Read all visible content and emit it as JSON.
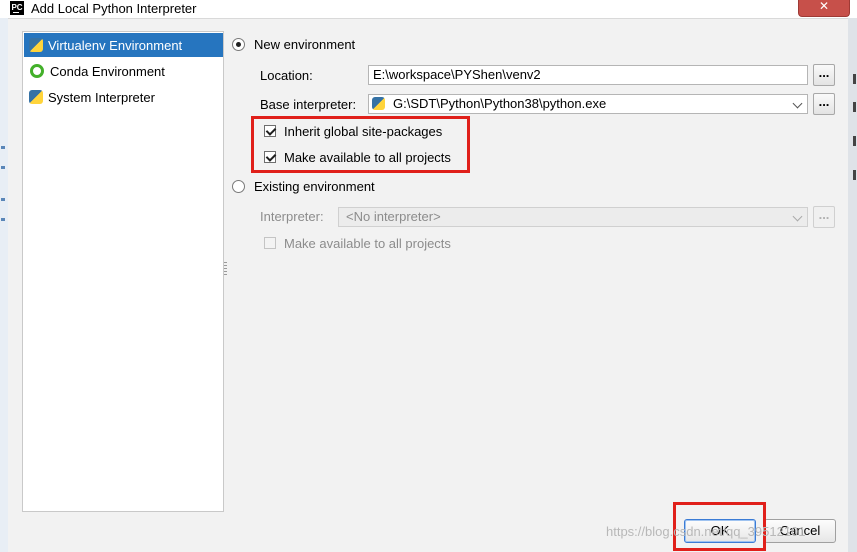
{
  "window": {
    "app_icon_text": "PC",
    "title": "Add Local Python Interpreter",
    "close_glyph": "✕"
  },
  "sidebar": {
    "items": [
      {
        "label": "Virtualenv Environment",
        "icon": "python-virtualenv-icon",
        "selected": true
      },
      {
        "label": "Conda Environment",
        "icon": "conda-icon",
        "selected": false
      },
      {
        "label": "System Interpreter",
        "icon": "python-icon",
        "selected": false
      }
    ]
  },
  "new_env": {
    "label": "New environment",
    "selected": true,
    "location_label": "Location:",
    "location_value": "E:\\workspace\\PYShen\\venv2",
    "base_label": "Base interpreter:",
    "base_value": "G:\\SDT\\Python\\Python38\\python.exe",
    "browse": "...",
    "inherit_label": "Inherit global site-packages",
    "inherit_checked": true,
    "make_available_label": "Make available to all projects",
    "make_available_checked": true
  },
  "existing_env": {
    "label": "Existing environment",
    "selected": false,
    "interpreter_label": "Interpreter:",
    "interpreter_value": "<No interpreter>",
    "browse": "...",
    "make_available_label": "Make available to all projects",
    "make_available_checked": false
  },
  "footer": {
    "ok_label": "OK",
    "cancel_label": "Cancel",
    "watermark": "https://blog.csdn.net/qq_39512101"
  },
  "colors": {
    "selection": "#2675bf",
    "highlight_box": "#e0201a",
    "close_button": "#c7504a"
  }
}
